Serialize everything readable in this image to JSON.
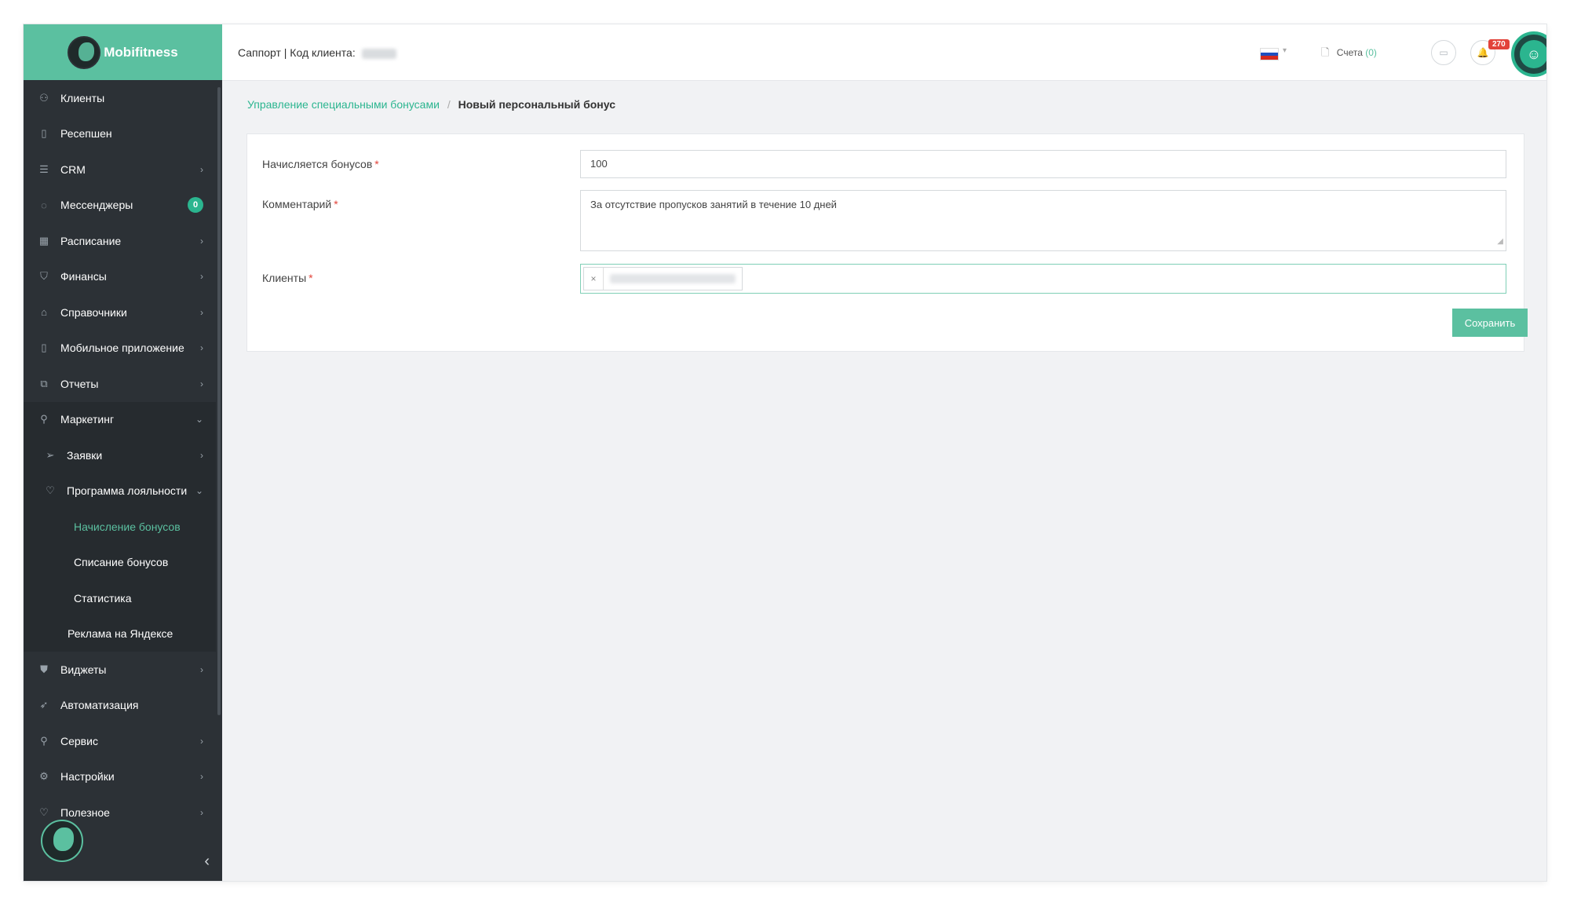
{
  "brand": {
    "name": "Mobifitness"
  },
  "topbar": {
    "support_label": "Саппорт | Код клиента:",
    "language_flag": "ru",
    "invoices_label": "Счета",
    "invoices_count": "(0)",
    "notifications_count": "270"
  },
  "sidebar": {
    "items": [
      {
        "label": "Клиенты",
        "icon": "clients-icon"
      },
      {
        "label": "Ресепшен",
        "icon": "reception-icon"
      },
      {
        "label": "CRM",
        "icon": "list-icon"
      },
      {
        "label": "Мессенджеры",
        "icon": "chat-icon",
        "badge": "0"
      },
      {
        "label": "Расписание",
        "icon": "calendar-icon"
      },
      {
        "label": "Финансы",
        "icon": "cart-icon"
      },
      {
        "label": "Справочники",
        "icon": "home-icon"
      },
      {
        "label": "Мобильное приложение",
        "icon": "phone-icon"
      },
      {
        "label": "Отчеты",
        "icon": "reports-icon"
      },
      {
        "label": "Маркетинг",
        "icon": "marketing-icon"
      },
      {
        "label": "Заявки",
        "icon": "send-icon"
      },
      {
        "label": "Программа лояльности",
        "icon": "thumb-icon"
      },
      {
        "label": "Начисление бонусов"
      },
      {
        "label": "Списание бонусов"
      },
      {
        "label": "Статистика"
      },
      {
        "label": "Реклама на Яндексе"
      },
      {
        "label": "Виджеты",
        "icon": "tag-icon"
      },
      {
        "label": "Автоматизация",
        "icon": "rocket-icon"
      },
      {
        "label": "Сервис",
        "icon": "wrench-icon"
      },
      {
        "label": "Настройки",
        "icon": "gear-icon"
      },
      {
        "label": "Полезное",
        "icon": "like-icon"
      }
    ]
  },
  "breadcrumb": {
    "parent": "Управление специальными бонусами",
    "separator": "/",
    "current": "Новый персональный бонус"
  },
  "form": {
    "bonus_label": "Начисляется бонусов",
    "bonus_value": "100",
    "comment_label": "Комментарий",
    "comment_value": "За отсутствие пропусков занятий в течение 10 дней",
    "clients_label": "Клиенты",
    "tag_remove": "×",
    "required_mark": "*",
    "save_label": "Сохранить"
  },
  "colors": {
    "accent": "#5bc0a0",
    "sidebar_bg": "#2c3136",
    "notification": "#e2433a"
  }
}
